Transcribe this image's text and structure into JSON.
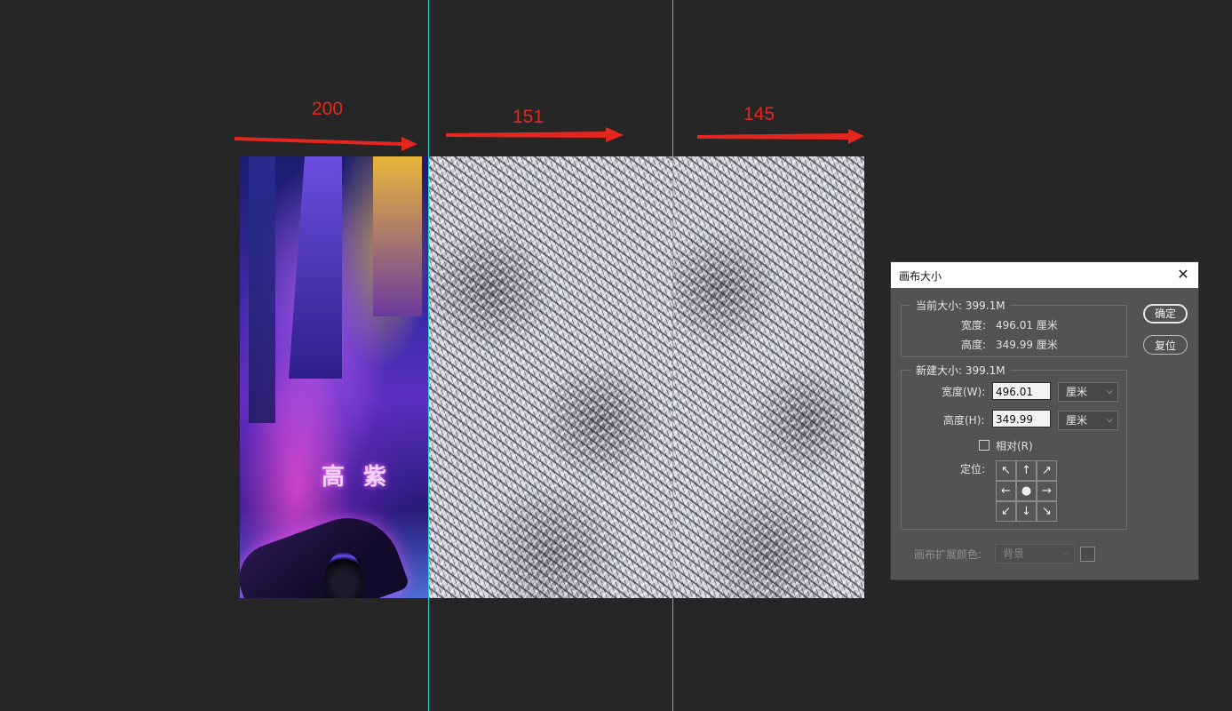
{
  "annotations": {
    "segments": [
      {
        "label": "200"
      },
      {
        "label": "151"
      },
      {
        "label": "145"
      }
    ],
    "arrow_color": "#e4261e",
    "guide_color": "#35c9d6"
  },
  "dialog": {
    "title": "画布大小",
    "close_glyph": "✕",
    "current_size": {
      "legend": "当前大小: 399.1M",
      "width_label": "宽度:",
      "width_value": "496.01 厘米",
      "height_label": "高度:",
      "height_value": "349.99 厘米"
    },
    "new_size": {
      "legend": "新建大小: 399.1M",
      "width_label": "宽度(W):",
      "width_value": "496.01",
      "width_unit": "厘米",
      "height_label": "高度(H):",
      "height_value": "349.99",
      "height_unit": "厘米",
      "relative_label": "相对(R)",
      "relative_checked": false,
      "anchor_label": "定位:",
      "anchor_cells": [
        "↖",
        "↑",
        "↗",
        "←",
        "●",
        "→",
        "↙",
        "↓",
        "↘"
      ]
    },
    "extension_color": {
      "label": "画布扩展颜色:",
      "value": "背景"
    },
    "ok_button": "确定",
    "reset_button": "复位"
  },
  "canvas": {
    "city_poster_text": "高 紫"
  }
}
